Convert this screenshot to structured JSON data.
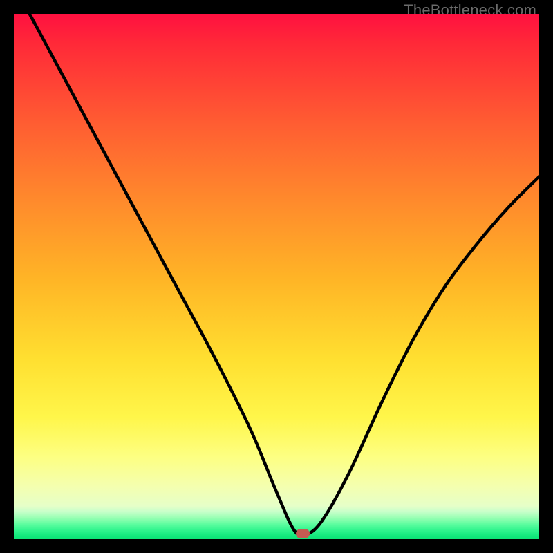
{
  "watermark": "TheBottleneck.com",
  "colors": {
    "marker": "#c45a52",
    "curve_stroke": "#000000"
  },
  "chart_data": {
    "type": "line",
    "title": "",
    "xlabel": "",
    "ylabel": "",
    "xlim": [
      0,
      100
    ],
    "ylim": [
      0,
      100
    ],
    "grid": false,
    "series": [
      {
        "name": "bottleneck-curve",
        "x": [
          3,
          10,
          17,
          24,
          31,
          38,
          45,
          50,
          53.5,
          56,
          59,
          64,
          70,
          76,
          82,
          88,
          94,
          100
        ],
        "y": [
          100,
          87,
          74,
          61,
          48,
          35,
          21,
          9,
          1.5,
          1,
          4,
          13,
          26,
          38,
          48,
          56,
          63,
          69
        ]
      }
    ],
    "annotations": [
      {
        "name": "minimum-marker",
        "x": 55,
        "y": 1
      }
    ]
  }
}
